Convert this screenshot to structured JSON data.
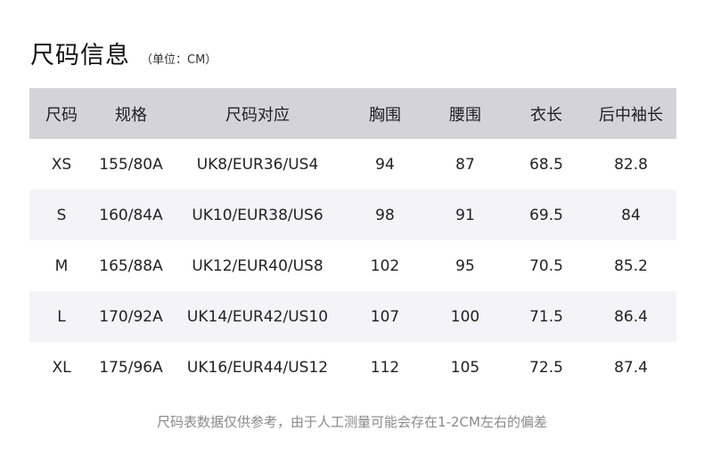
{
  "header": {
    "title": "尺码信息",
    "unit": "（单位：CM）"
  },
  "table": {
    "headers": [
      "尺码",
      "规格",
      "尺码对应",
      "胸围",
      "腰围",
      "衣长",
      "后中袖长"
    ],
    "rows": [
      [
        "XS",
        "155/80A",
        "UK8/EUR36/US4",
        "94",
        "87",
        "68.5",
        "82.8"
      ],
      [
        "S",
        "160/84A",
        "UK10/EUR38/US6",
        "98",
        "91",
        "69.5",
        "84"
      ],
      [
        "M",
        "165/88A",
        "UK12/EUR40/US8",
        "102",
        "95",
        "70.5",
        "85.2"
      ],
      [
        "L",
        "170/92A",
        "UK14/EUR42/US10",
        "107",
        "100",
        "71.5",
        "86.4"
      ],
      [
        "XL",
        "175/96A",
        "UK16/EUR44/US12",
        "112",
        "105",
        "72.5",
        "87.4"
      ]
    ]
  },
  "footer": {
    "note": "尺码表数据仅供参考，由于人工测量可能会存在1-2CM左右的偏差"
  },
  "colors": {
    "header_bg": "#d4d4d8",
    "alt_row_bg": "#f4f4f8",
    "note_text": "#8a8a8a"
  }
}
